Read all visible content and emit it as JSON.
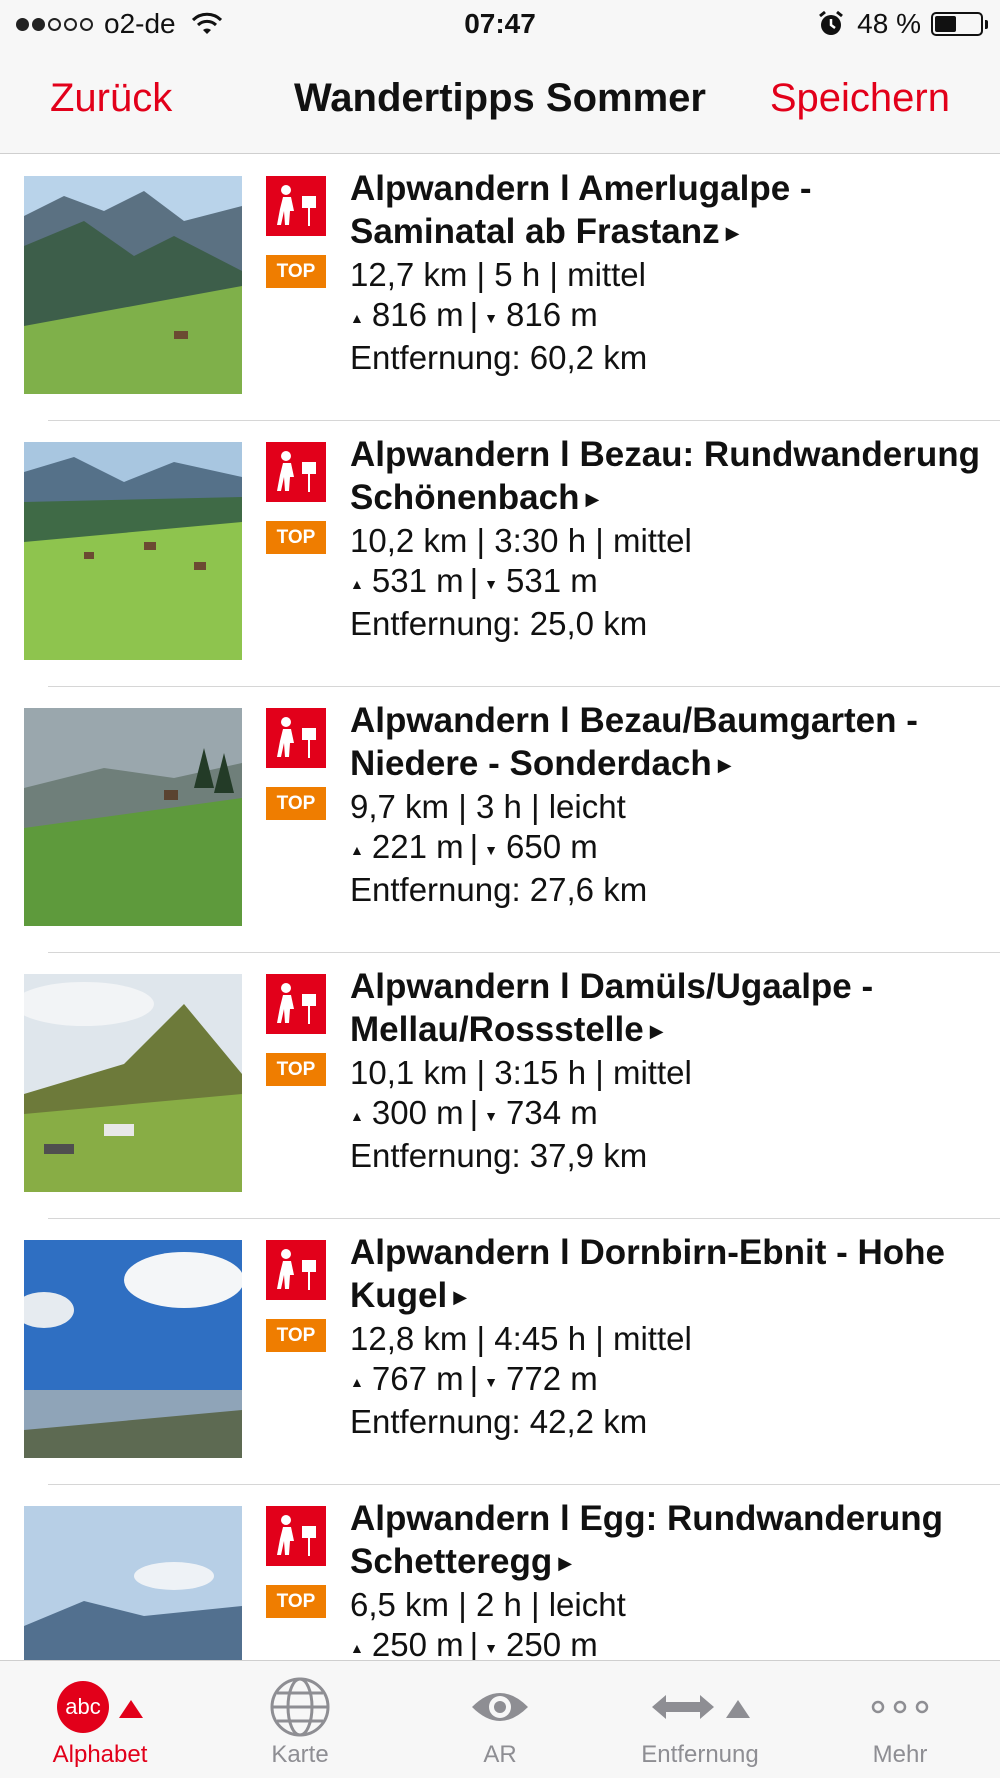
{
  "status_bar": {
    "carrier": "o2-de",
    "time": "07:47",
    "battery": "48 %",
    "signal_bars_filled": 2,
    "signal_bars_total": 5
  },
  "nav": {
    "back_label": "Zurück",
    "title": "Wandertipps Sommer",
    "save_label": "Speichern"
  },
  "colors": {
    "accent": "#e2001a",
    "badge": "#ef7d00"
  },
  "badge_label": "TOP",
  "items": [
    {
      "title": "Alpwandern l Amerlugalpe - Saminatal ab Frastanz",
      "stats": "12,7 km | 5 h | mittel",
      "ascent": "816 m",
      "descent": "816 m",
      "distance": "Entfernung: 60,2 km",
      "image": "mountain-valley-meadow"
    },
    {
      "title": "Alpwandern l Bezau: Rundwanderung Schönenbach",
      "stats": "10,2 km | 3:30 h | mittel",
      "ascent": "531 m",
      "descent": "531 m",
      "distance": "Entfernung: 25,0 km",
      "image": "alpine-village-meadow"
    },
    {
      "title": "Alpwandern l Bezau/Baumgarten - Niedere - Sonderdach",
      "stats": "9,7 km | 3 h | leicht",
      "ascent": "221 m",
      "descent": "650 m",
      "distance": "Entfernung: 27,6 km",
      "image": "foggy-hill-meadow"
    },
    {
      "title": "Alpwandern l Damüls/Ugaalpe - Mellau/Rossstelle",
      "stats": "10,1 km | 3:15 h | mittel",
      "ascent": "300 m",
      "descent": "734 m",
      "distance": "Entfernung: 37,9 km",
      "image": "peak-with-alp-huts"
    },
    {
      "title": "Alpwandern l Dornbirn-Ebnit - Hohe Kugel",
      "stats": "12,8 km | 4:45 h | mittel",
      "ascent": "767 m",
      "descent": "772 m",
      "distance": "Entfernung: 42,2 km",
      "image": "blue-sky-lake-view"
    },
    {
      "title": "Alpwandern l Egg: Rundwanderung Schetteregg",
      "stats": "6,5 km | 2 h | leicht",
      "ascent": "250 m",
      "descent": "250 m",
      "distance": "",
      "image": "sky-over-hills"
    }
  ],
  "tabs": [
    {
      "label": "Alphabet",
      "icon": "abc-sort-icon",
      "icon_text": "abc",
      "active": true
    },
    {
      "label": "Karte",
      "icon": "globe-icon",
      "active": false
    },
    {
      "label": "AR",
      "icon": "eye-icon",
      "active": false
    },
    {
      "label": "Entfernung",
      "icon": "distance-arrows-icon",
      "active": false
    },
    {
      "label": "Mehr",
      "icon": "more-dots-icon",
      "active": false
    }
  ]
}
